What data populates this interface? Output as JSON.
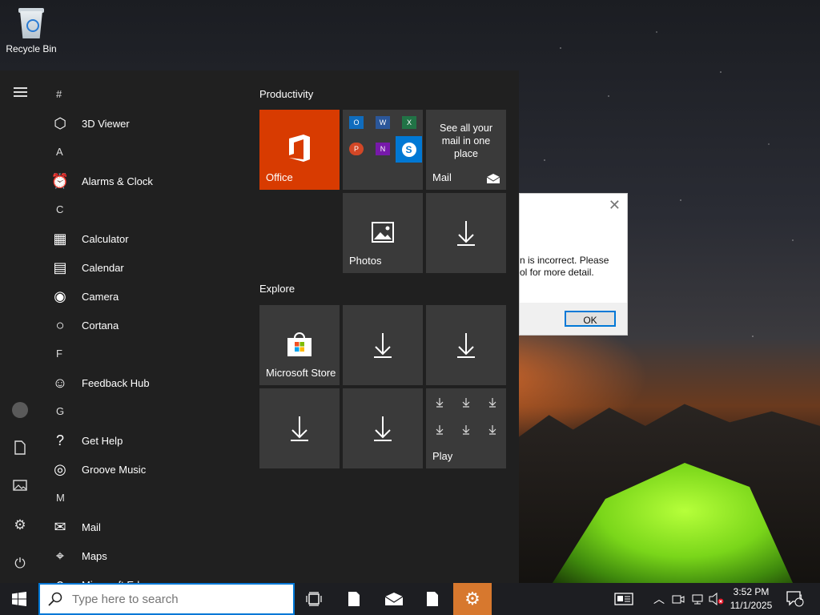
{
  "desktop": {
    "recycle_bin_label": "Recycle Bin"
  },
  "start_menu": {
    "apps": [
      {
        "type": "letter",
        "label": "#"
      },
      {
        "type": "app",
        "label": "3D Viewer",
        "icon": "cube-icon"
      },
      {
        "type": "letter",
        "label": "A"
      },
      {
        "type": "app",
        "label": "Alarms & Clock",
        "icon": "alarm-clock-icon"
      },
      {
        "type": "letter",
        "label": "C"
      },
      {
        "type": "app",
        "label": "Calculator",
        "icon": "calculator-icon"
      },
      {
        "type": "app",
        "label": "Calendar",
        "icon": "calendar-icon"
      },
      {
        "type": "app",
        "label": "Camera",
        "icon": "camera-icon"
      },
      {
        "type": "app",
        "label": "Cortana",
        "icon": "cortana-icon"
      },
      {
        "type": "letter",
        "label": "F"
      },
      {
        "type": "app",
        "label": "Feedback Hub",
        "icon": "feedback-icon"
      },
      {
        "type": "letter",
        "label": "G"
      },
      {
        "type": "app",
        "label": "Get Help",
        "icon": "help-icon"
      },
      {
        "type": "app",
        "label": "Groove Music",
        "icon": "music-icon"
      },
      {
        "type": "letter",
        "label": "M"
      },
      {
        "type": "app",
        "label": "Mail",
        "icon": "mail-icon"
      },
      {
        "type": "app",
        "label": "Maps",
        "icon": "maps-icon"
      },
      {
        "type": "app",
        "label": "Microsoft Edge",
        "icon": "edge-icon"
      }
    ],
    "sections": {
      "productivity": "Productivity",
      "explore": "Explore"
    },
    "tiles": {
      "office": "Office",
      "mail_promo": "See all your mail in one place",
      "mail": "Mail",
      "photos": "Photos",
      "store": "Microsoft Store",
      "play": "Play"
    },
    "colors": {
      "office_tile": "#d83b01",
      "menu_bg": "#202020",
      "tile_bg": "#3a3a3a"
    }
  },
  "dialog": {
    "message_line1": "n is incorrect. Please",
    "message_line2": "ol for more detail.",
    "ok_label": "OK"
  },
  "taskbar": {
    "search_placeholder": "Type here to search",
    "clock_time": "3:52 PM",
    "clock_date": "11/1/2025",
    "notification_count": "1",
    "accent_color": "#d7782e"
  }
}
